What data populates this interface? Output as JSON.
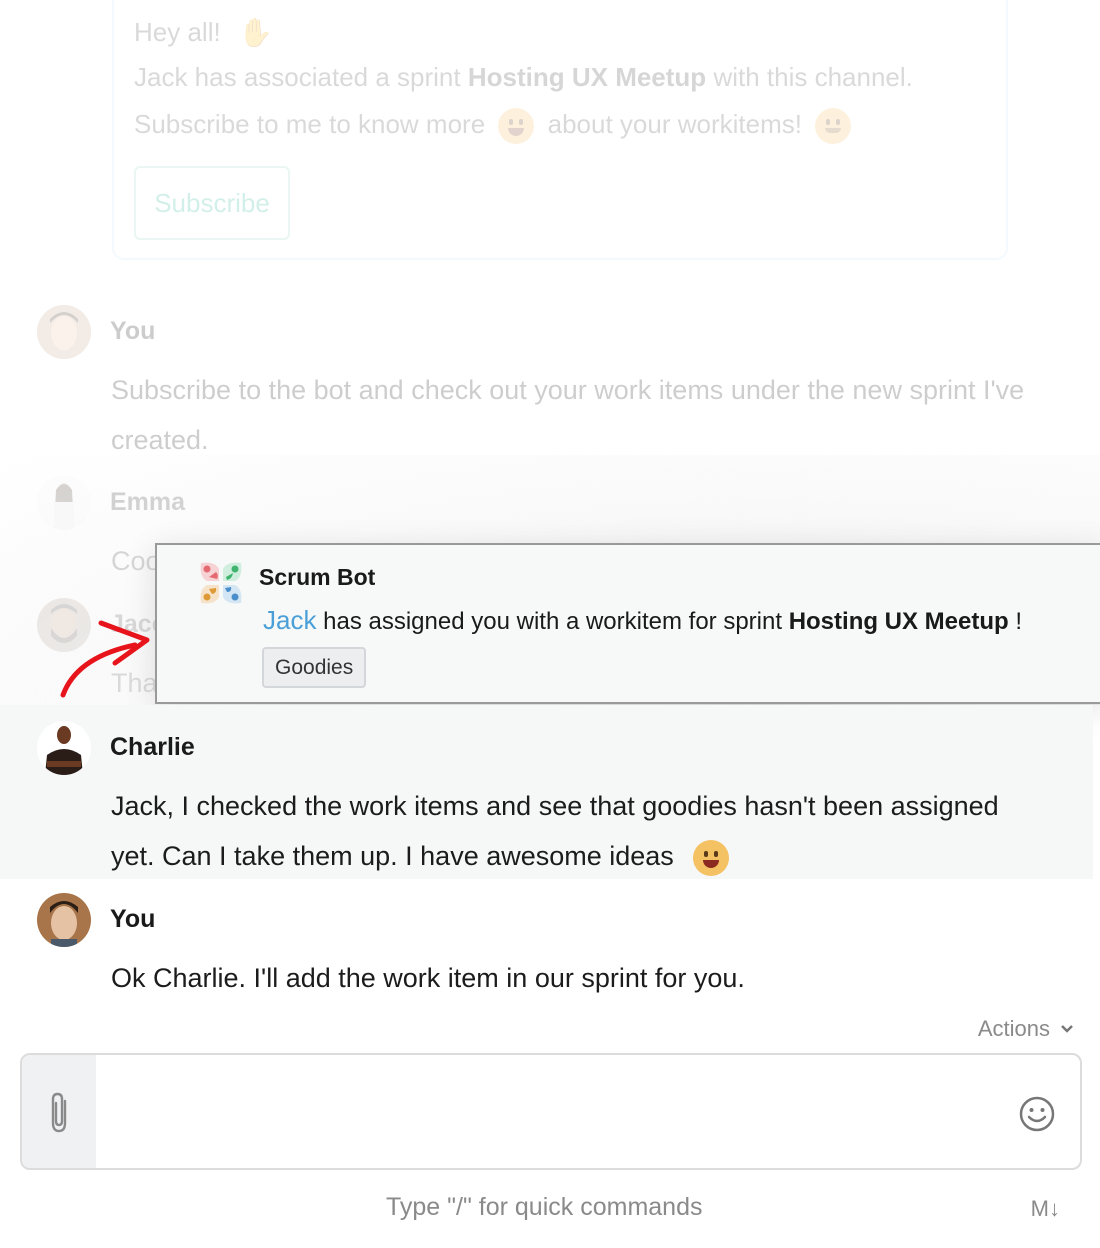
{
  "bot_card": {
    "greeting": "Hey all!",
    "line2_prefix": "Jack has associated a sprint",
    "sprint_name": "Hosting UX Meetup",
    "line2_suffix": "with this channel.",
    "line3_prefix": "Subscribe to me to know more",
    "line3_suffix": "about your workitems!",
    "subscribe_label": "Subscribe",
    "emoji_wave": "waving-hand",
    "emoji_idea": "light-bulb-face",
    "emoji_smile": "smiling-face"
  },
  "messages": [
    {
      "sender": "You",
      "text": "Subscribe to the bot and check out your work items under the new sprint I've created."
    },
    {
      "sender": "Emma",
      "text": "Coo"
    },
    {
      "sender": "Jace",
      "text": "Tha"
    },
    {
      "sender": "Charlie",
      "text": "Jack, I checked the work items and see that goodies hasn't been assigned yet. Can I take them up. I have awesome ideas",
      "emoji": "light-bulb-face"
    },
    {
      "sender": "You",
      "text": "Ok Charlie. I'll add the work item in our sprint for you."
    }
  ],
  "notification": {
    "bot_name": "Scrum Bot",
    "mention": "Jack",
    "text": "has assigned you with a workitem for sprint",
    "sprint_name": "Hosting UX Meetup",
    "suffix": "!",
    "tag": "Goodies",
    "mention_color": "#4a9fd8"
  },
  "composer": {
    "actions_label": "Actions",
    "placeholder": "",
    "hint": "Type \"/\" for quick commands",
    "markdown_label": "M↓"
  },
  "colors": {
    "accent_green": "#36b59a",
    "arrow_red": "#e8141c"
  }
}
